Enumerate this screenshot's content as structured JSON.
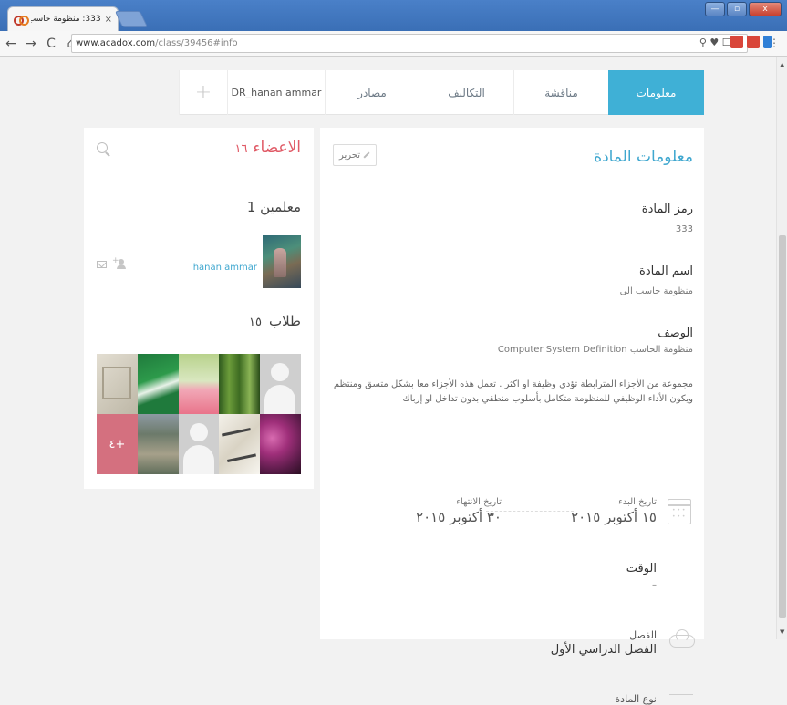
{
  "browser": {
    "tab_title": "333: منظومة حاسب الى mar",
    "tab_close": "×",
    "url_domain": "www.acadox.com",
    "url_path": "/class/39456#info",
    "nav": {
      "back": "←",
      "forward": "→",
      "reload": "C",
      "home": "⌂"
    },
    "info_badge": "i",
    "omnibox_icons": "⚲ ♥ ☐ ☆",
    "ext_colors": [
      "#d9463a",
      "#d9463a",
      "#2f7fd6"
    ],
    "window_buttons": {
      "minimize": "—",
      "restore": "▫",
      "close": "x"
    }
  },
  "nav_tabs": [
    {
      "label": "معلومات",
      "active": true
    },
    {
      "label": "مناقشة",
      "active": false
    },
    {
      "label": "التكاليف",
      "active": false
    },
    {
      "label": "مصادر",
      "active": false
    },
    {
      "label": "DR_hanan ammar",
      "active": false
    },
    {
      "label": "+",
      "active": false
    }
  ],
  "members": {
    "title": "الاعضاء",
    "count": "١٦",
    "teachers_label": "معلمين 1",
    "teacher_name": "hanan ammar",
    "students_label": "طلاب",
    "students_count": "١٥",
    "more_label": "٤+"
  },
  "course_info": {
    "heading": "معلومات المادة",
    "edit_label": "تحرير",
    "code_label": "رمز المادة",
    "code_value": "333",
    "name_label": "اسم المادة",
    "name_value": "منظومة حاسب الى",
    "desc_label": "الوصف",
    "desc_value": "منظومة الحاسب Computer System Definition",
    "desc_long": "مجموعة من الأجزاء المترابطة تؤدي وظيفة او اكثر . تعمل هذه الأجزاء معا بشكل متسق ومنتظم ويكون الأداء الوظيفي للمنظومة متكامل بأسلوب منطقي بدون تداخل او إرباك",
    "start_label": "تاريخ البدء",
    "start_date": "١٥ أكتوبر ٢٠١٥",
    "end_label": "تاريخ الانتهاء",
    "end_date": "٣٠ أكتوبر ٢٠١٥",
    "time_label": "الوقت",
    "time_value": "–",
    "semester_label": "الفصل",
    "semester_value": "الفصل الدراسي الأول",
    "type_label": "نوع المادة"
  },
  "colors": {
    "accent": "#3fb0d6",
    "members_title": "#e05a66",
    "link": "#3fa7cf"
  }
}
